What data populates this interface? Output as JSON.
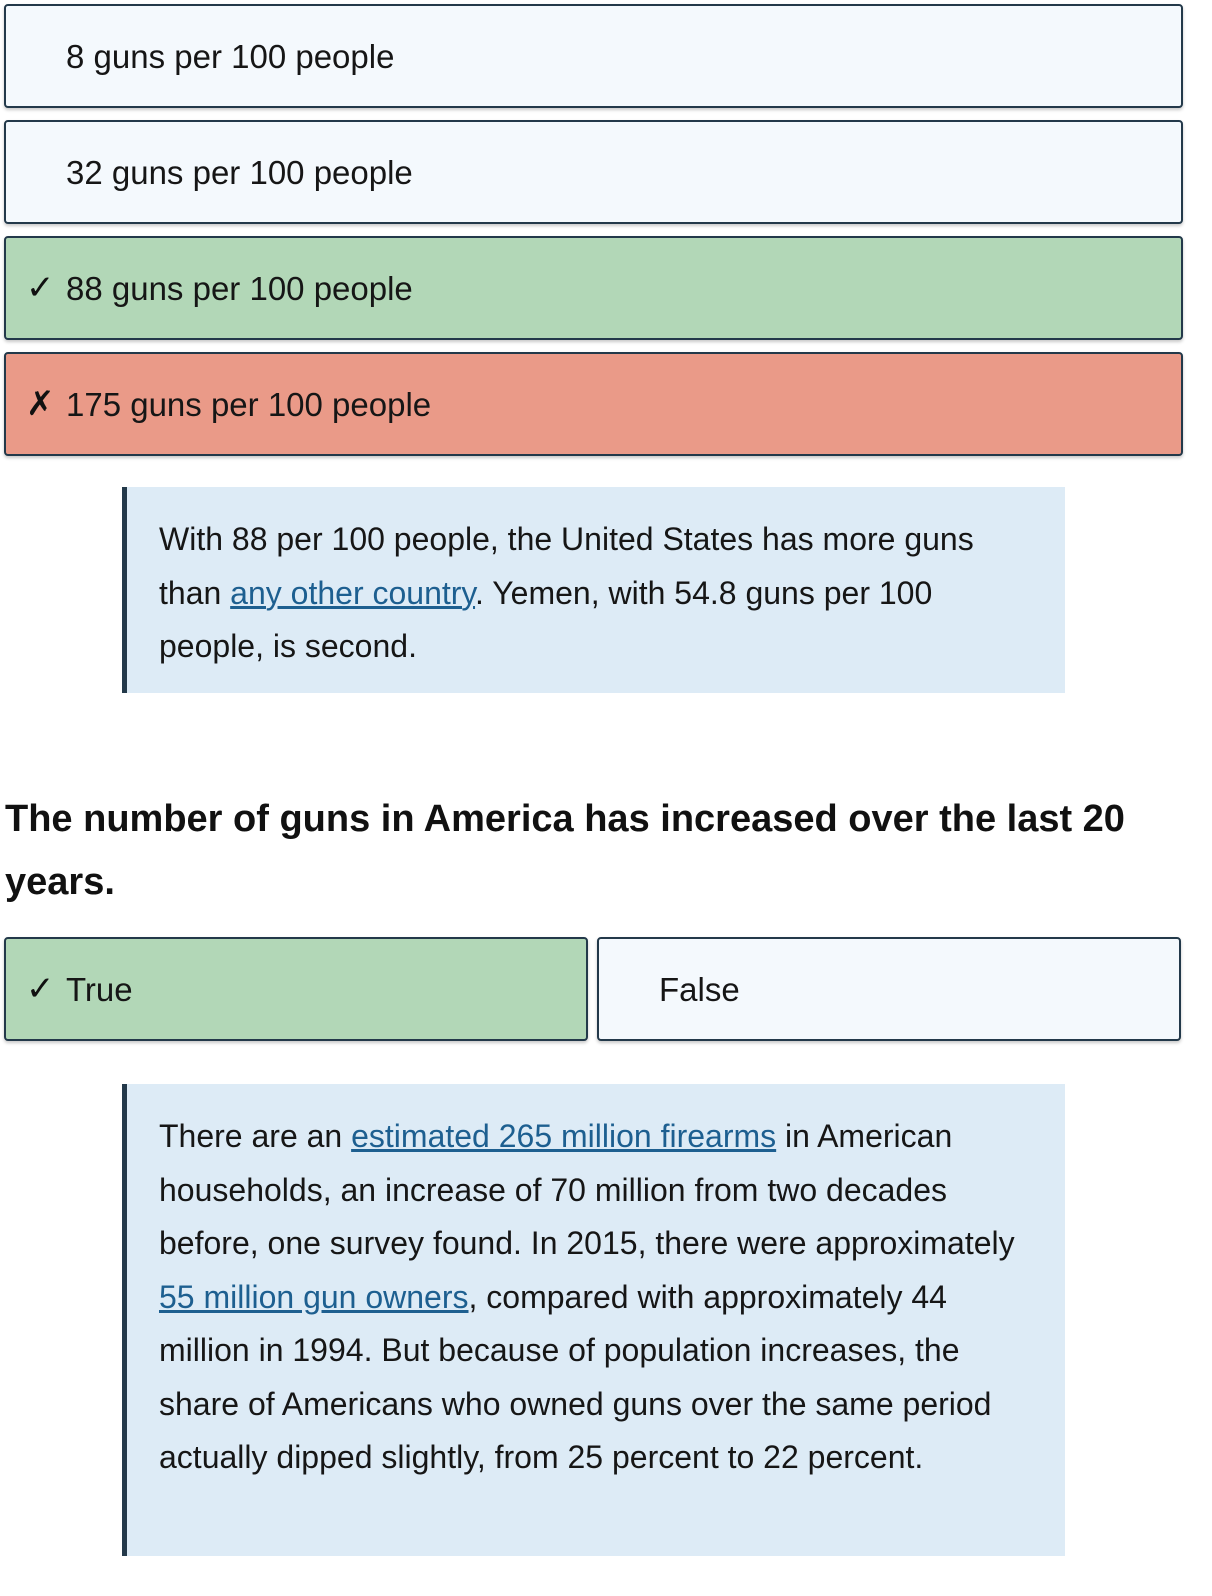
{
  "q1": {
    "options": [
      {
        "label": "8 guns per 100 people",
        "state": "",
        "mark": ""
      },
      {
        "label": "32 guns per 100 people",
        "state": "",
        "mark": ""
      },
      {
        "label": "88 guns per 100 people",
        "state": "correct",
        "mark": "✓"
      },
      {
        "label": "175 guns per 100 people",
        "state": "wrong",
        "mark": "✗"
      }
    ],
    "explanation": {
      "pre": "With 88 per 100 people, the United States has more guns than ",
      "link": "any other country",
      "post": ". Yemen, with 54.8 guns per 100 people, is second."
    }
  },
  "q2": {
    "question": "The number of guns in America has increased over the last 20 years.",
    "options": [
      {
        "label": "True",
        "state": "correct",
        "mark": "✓"
      },
      {
        "label": "False",
        "state": "",
        "mark": ""
      }
    ],
    "explanation": {
      "t1": "There are an ",
      "link1": "estimated 265 million firearms",
      "t2": " in American households, an increase of 70 million from two decades before, one survey found. In 2015, there were approximately ",
      "link2": "55 million gun owners",
      "t3": ", compared with approximately 44 million in 1994. But because of population increases, the share of Americans who owned guns over the same period actually dipped slightly, from 25 percent to 22 percent."
    }
  },
  "colors": {
    "correct_bg": "#b2d7b7",
    "wrong_bg": "#ea9a88",
    "option_bg": "#f4f9fd",
    "explanation_bg": "#ddebf6",
    "border": "#23394a",
    "link": "#1d5f90"
  }
}
